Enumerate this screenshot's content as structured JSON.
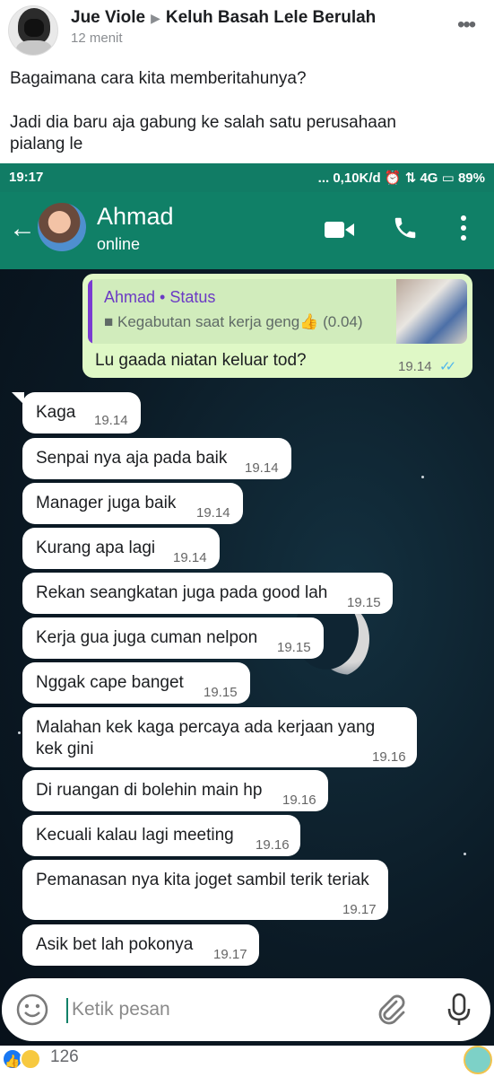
{
  "post": {
    "author": "Jue Viole",
    "group": "Keluh Basah Lele Berulah",
    "time": "12 menit",
    "text_line1": "Bagaimana cara kita memberitahunya?",
    "text_line2": "Jadi dia baru aja gabung ke salah satu perusahaan",
    "text_line3": "pialang le",
    "reaction_count": "126"
  },
  "status_bar": {
    "time": "19:17",
    "indicators": "... 0,10K/d ⏰ ⇅ 4G ▭ 89%"
  },
  "chat": {
    "contact_name": "Ahmad",
    "contact_status": "online",
    "sent": {
      "quote_title": "Ahmad • Status",
      "quote_subtitle": "Kegabutan saat kerja geng👍 (0.04)",
      "text": "Lu gaada niatan keluar tod?",
      "time": "19.14",
      "ticks": "✓✓"
    },
    "messages": [
      {
        "text": "Kaga",
        "time": "19.14"
      },
      {
        "text": "Senpai nya aja pada baik",
        "time": "19.14"
      },
      {
        "text": "Manager juga baik",
        "time": "19.14"
      },
      {
        "text": "Kurang apa lagi",
        "time": "19.14"
      },
      {
        "text": "Rekan seangkatan juga pada good lah",
        "time": "19.15"
      },
      {
        "text": "Kerja gua juga cuman nelpon",
        "time": "19.15"
      },
      {
        "text": "Nggak cape banget",
        "time": "19.15"
      },
      {
        "text": "Malahan kek kaga percaya ada kerjaan yang kek gini",
        "time": "19.16"
      },
      {
        "text": "Di ruangan di bolehin main hp",
        "time": "19.16"
      },
      {
        "text": "Kecuali kalau lagi meeting",
        "time": "19.16"
      },
      {
        "text": "Pemanasan nya kita joget sambil terik teriak",
        "time": "19.17"
      },
      {
        "text": "Asik bet lah pokonya",
        "time": "19.17"
      }
    ],
    "input_placeholder": "Ketik pesan"
  },
  "icons": {
    "back": "arrow-left-icon",
    "video": "video-call-icon",
    "call": "phone-icon",
    "more": "more-vert-icon",
    "emoji": "emoji-icon",
    "attach": "paperclip-icon",
    "mic": "mic-icon"
  },
  "colors": {
    "whatsapp_green": "#108067",
    "sent_bubble": "#dff8c6",
    "quote_accent": "#7a3bd1",
    "read_ticks": "#4fb6ec"
  }
}
